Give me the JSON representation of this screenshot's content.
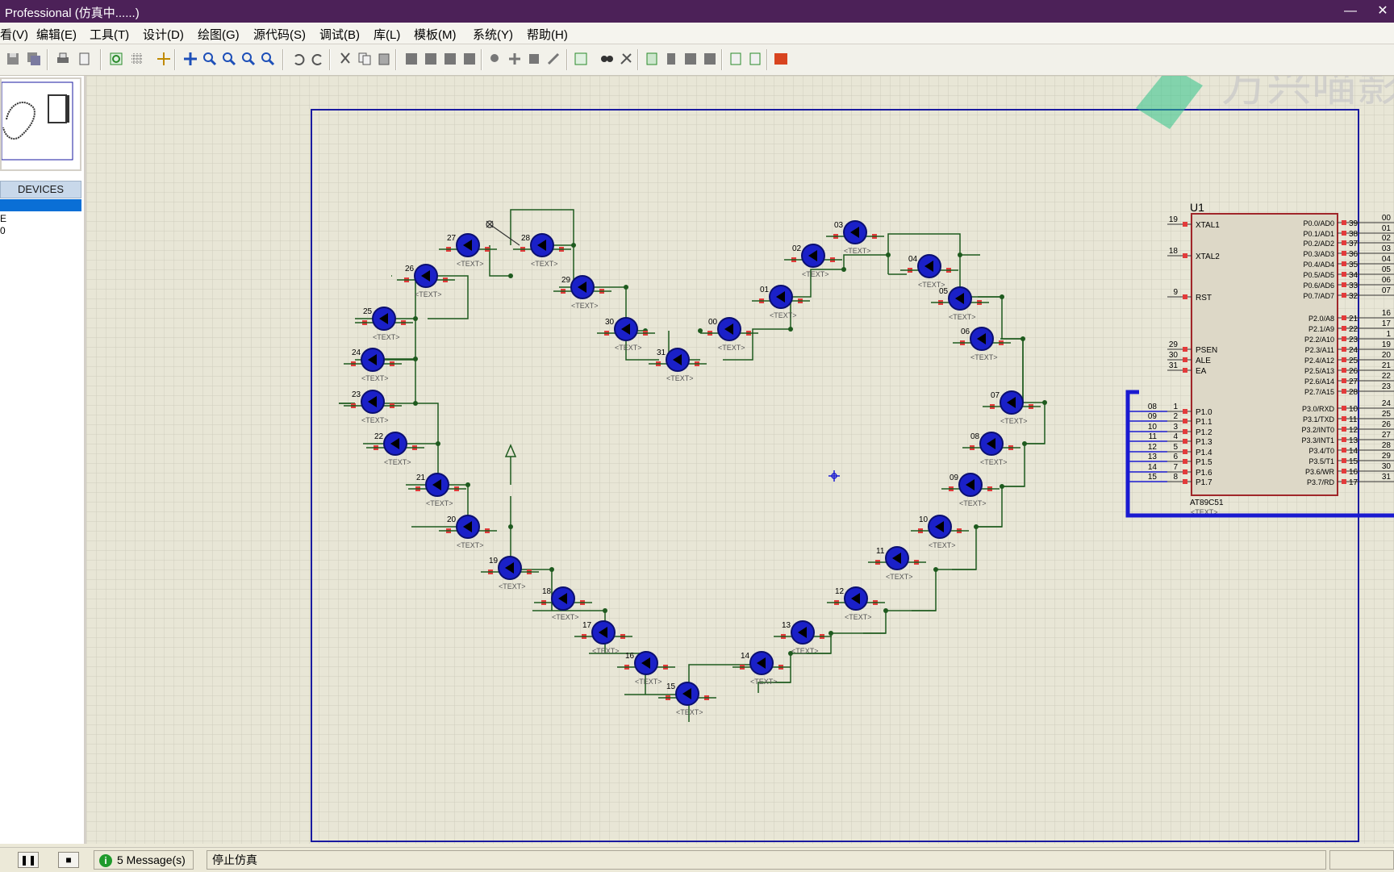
{
  "window": {
    "title": "Professional (仿真中......)",
    "minimize_glyph": "—",
    "close_glyph": "✕"
  },
  "menu": [
    "看(V)",
    "编辑(E)",
    "工具(T)",
    "设计(D)",
    "绘图(G)",
    "源代码(S)",
    "调试(B)",
    "库(L)",
    "模板(M)",
    "系统(Y)",
    "帮助(H)"
  ],
  "toolbar_icons": [
    "save-icon",
    "save-all-icon",
    "print-icon",
    "page-setup-icon",
    "refresh-icon",
    "grid-icon",
    "origin-icon",
    "pan-icon",
    "zoom-in-icon",
    "zoom-out-icon",
    "zoom-all-icon",
    "zoom-area-icon",
    "undo-icon",
    "redo-icon",
    "cut-icon",
    "copy-icon",
    "paste-icon",
    "block-copy-icon",
    "block-move-icon",
    "block-rotate-icon",
    "block-delete-icon",
    "pick-device-icon",
    "make-device-icon",
    "package-tool-icon",
    "decompose-icon",
    "wire-autoroute-icon",
    "search-icon",
    "property-assign-icon",
    "new-sheet-icon",
    "remove-sheet-icon",
    "goto-sheet-icon",
    "hierarchy-icon",
    "bom-icon",
    "erc-icon",
    "ares-icon"
  ],
  "watermark": {
    "text": "万兴喵影"
  },
  "left_panel": {
    "devices_header": "DEVICES",
    "device_items": [
      "E",
      "0"
    ]
  },
  "schematic": {
    "leds": [
      {
        "label": "27",
        "text": "<TEXT>"
      },
      {
        "label": "28",
        "text": "<TEXT>"
      },
      {
        "label": "26",
        "text": "<TEXT>"
      },
      {
        "label": "29",
        "text": "<TEXT>"
      },
      {
        "label": "25",
        "text": "<TEXT>"
      },
      {
        "label": "30",
        "text": "<TEXT>"
      },
      {
        "label": "24",
        "text": "<TEXT>"
      },
      {
        "label": "31",
        "text": "<TEXT>"
      },
      {
        "label": "23",
        "text": "<TEXT>"
      },
      {
        "label": "00",
        "text": "<TEXT>"
      },
      {
        "label": "22",
        "text": "<TEXT>"
      },
      {
        "label": "01",
        "text": "<TEXT>"
      },
      {
        "label": "21",
        "text": "<TEXT>"
      },
      {
        "label": "02",
        "text": "<TEXT>"
      },
      {
        "label": "20",
        "text": "<TEXT>"
      },
      {
        "label": "03",
        "text": "<TEXT>"
      },
      {
        "label": "19",
        "text": "<TEXT>"
      },
      {
        "label": "04",
        "text": "<TEXT>"
      },
      {
        "label": "18",
        "text": "<TEXT>"
      },
      {
        "label": "05",
        "text": "<TEXT>"
      },
      {
        "label": "17",
        "text": "<TEXT>"
      },
      {
        "label": "06",
        "text": "<TEXT>"
      },
      {
        "label": "16",
        "text": "<TEXT>"
      },
      {
        "label": "07",
        "text": "<TEXT>"
      },
      {
        "label": "15",
        "text": "<TEXT>"
      },
      {
        "label": "08",
        "text": "<TEXT>"
      },
      {
        "label": "14",
        "text": "<TEXT>"
      },
      {
        "label": "09",
        "text": "<TEXT>"
      },
      {
        "label": "13",
        "text": "<TEXT>"
      },
      {
        "label": "10",
        "text": "<TEXT>"
      },
      {
        "label": "12",
        "text": "<TEXT>"
      },
      {
        "label": "11",
        "text": "<TEXT>"
      }
    ],
    "mcu": {
      "ref": "U1",
      "part": "AT89C51",
      "text": "<TEXT>",
      "left_pins": [
        {
          "num": "19",
          "name": "XTAL1"
        },
        {
          "num": "18",
          "name": "XTAL2"
        },
        {
          "num": "9",
          "name": "RST"
        },
        {
          "num": "29",
          "name": "PSEN"
        },
        {
          "num": "30",
          "name": "ALE"
        },
        {
          "num": "31",
          "name": "EA"
        },
        {
          "num": "1",
          "name": "P1.0",
          "net": "08"
        },
        {
          "num": "2",
          "name": "P1.1",
          "net": "09"
        },
        {
          "num": "3",
          "name": "P1.2",
          "net": "10"
        },
        {
          "num": "4",
          "name": "P1.3",
          "net": "11"
        },
        {
          "num": "5",
          "name": "P1.4",
          "net": "12"
        },
        {
          "num": "6",
          "name": "P1.5",
          "net": "13"
        },
        {
          "num": "7",
          "name": "P1.6",
          "net": "14"
        },
        {
          "num": "8",
          "name": "P1.7",
          "net": "15"
        }
      ],
      "right_pins": [
        {
          "num": "39",
          "name": "P0.0/AD0",
          "net": "00"
        },
        {
          "num": "38",
          "name": "P0.1/AD1",
          "net": "01"
        },
        {
          "num": "37",
          "name": "P0.2/AD2",
          "net": "02"
        },
        {
          "num": "36",
          "name": "P0.3/AD3",
          "net": "03"
        },
        {
          "num": "35",
          "name": "P0.4/AD4",
          "net": "04"
        },
        {
          "num": "34",
          "name": "P0.5/AD5",
          "net": "05"
        },
        {
          "num": "33",
          "name": "P0.6/AD6",
          "net": "06"
        },
        {
          "num": "32",
          "name": "P0.7/AD7",
          "net": "07"
        },
        {
          "num": "21",
          "name": "P2.0/A8",
          "net": "16"
        },
        {
          "num": "22",
          "name": "P2.1/A9",
          "net": "17"
        },
        {
          "num": "23",
          "name": "P2.2/A10",
          "net": "1"
        },
        {
          "num": "24",
          "name": "P2.3/A11",
          "net": "19"
        },
        {
          "num": "25",
          "name": "P2.4/A12",
          "net": "20"
        },
        {
          "num": "26",
          "name": "P2.5/A13",
          "net": "21"
        },
        {
          "num": "27",
          "name": "P2.6/A14",
          "net": "22"
        },
        {
          "num": "28",
          "name": "P2.7/A15",
          "net": "23"
        },
        {
          "num": "10",
          "name": "P3.0/RXD",
          "net": "24"
        },
        {
          "num": "11",
          "name": "P3.1/TXD",
          "net": "25"
        },
        {
          "num": "12",
          "name": "P3.2/INT0",
          "net": "26"
        },
        {
          "num": "13",
          "name": "P3.3/INT1",
          "net": "27"
        },
        {
          "num": "14",
          "name": "P3.4/T0",
          "net": "28"
        },
        {
          "num": "15",
          "name": "P3.5/T1",
          "net": "29"
        },
        {
          "num": "16",
          "name": "P3.6/WR",
          "net": "30"
        },
        {
          "num": "17",
          "name": "P3.7/RD",
          "net": "31"
        }
      ]
    }
  },
  "status": {
    "messages": "5 Message(s)",
    "state": "停止仿真",
    "controls": [
      "pause",
      "stop"
    ]
  },
  "colors": {
    "title_bar": "#4c2158",
    "canvas_bg": "#e8e6d6",
    "grid": "#cfcdbd",
    "sheet_border": "#1a1aa0",
    "led": "#1a20c8",
    "pin": "#e23b3b",
    "wire": "#1e5a1e",
    "bus": "#1a1ad0",
    "mcu_fill": "#ddd8c7",
    "mcu_border": "#a0262a"
  }
}
